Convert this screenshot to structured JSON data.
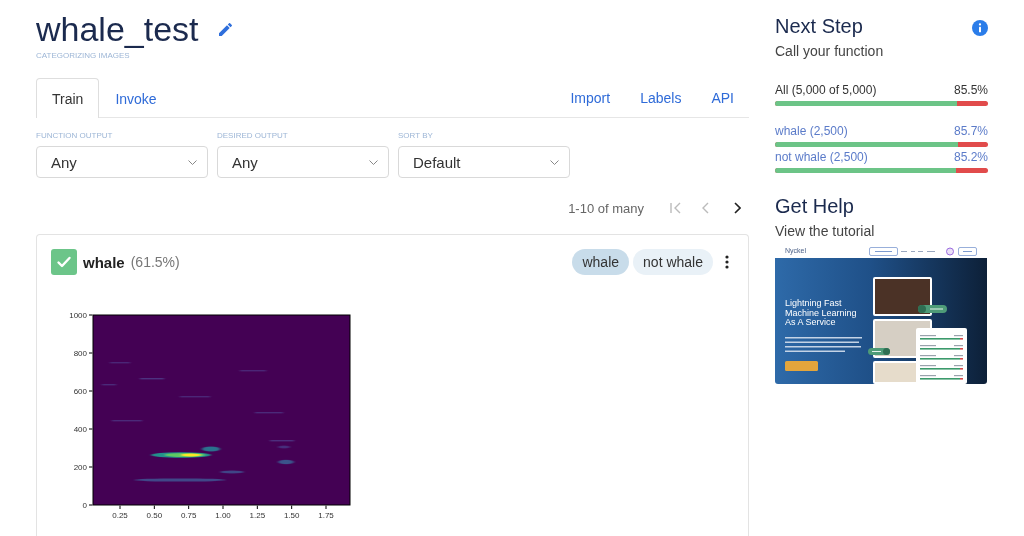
{
  "header": {
    "title": "whale_test",
    "subtitle": "CATEGORIZING IMAGES"
  },
  "tabs": [
    {
      "label": "Train",
      "selected": true
    },
    {
      "label": "Invoke",
      "selected": false
    }
  ],
  "links": [
    "Import",
    "Labels",
    "API"
  ],
  "filters": [
    {
      "label": "FUNCTION OUTPUT",
      "value": "Any"
    },
    {
      "label": "DESIRED OUTPUT",
      "value": "Any"
    },
    {
      "label": "SORT BY",
      "value": "Default"
    }
  ],
  "pagination": {
    "range": "1-10 of many",
    "first_disabled": true,
    "prev_disabled": true,
    "next_disabled": false
  },
  "samples": [
    {
      "label": "whale",
      "confidence": "(61.5%)",
      "correct": true,
      "label_options": [
        {
          "label": "whale",
          "selected": true
        },
        {
          "label": "not whale",
          "selected": false
        }
      ],
      "spectrogram": {
        "y_tick_labels": [
          "1000",
          "800",
          "600",
          "400",
          "200",
          "0"
        ],
        "x_tick_labels": [
          "0.25",
          "0.50",
          "0.75",
          "1.00",
          "1.25",
          "1.50",
          "1.75"
        ]
      }
    }
  ],
  "next_step": {
    "title": "Next Step",
    "subtitle": "Call your function",
    "stats": [
      {
        "kind": "total",
        "label": "All (5,000 of 5,000)",
        "reading": "85.5%",
        "level": 0.855
      },
      {
        "kind": "label",
        "label": "whale (2,500)",
        "reading": "85.7%",
        "level": 0.857
      },
      {
        "kind": "label",
        "label": "not whale (2,500)",
        "reading": "85.2%",
        "level": 0.852
      }
    ]
  },
  "help": {
    "title": "Get Help",
    "subtitle": "View the tutorial",
    "thumbnail": {
      "logo": "Nyckel",
      "heading": "Lightning Fast Machine Learning As A Service"
    }
  }
}
